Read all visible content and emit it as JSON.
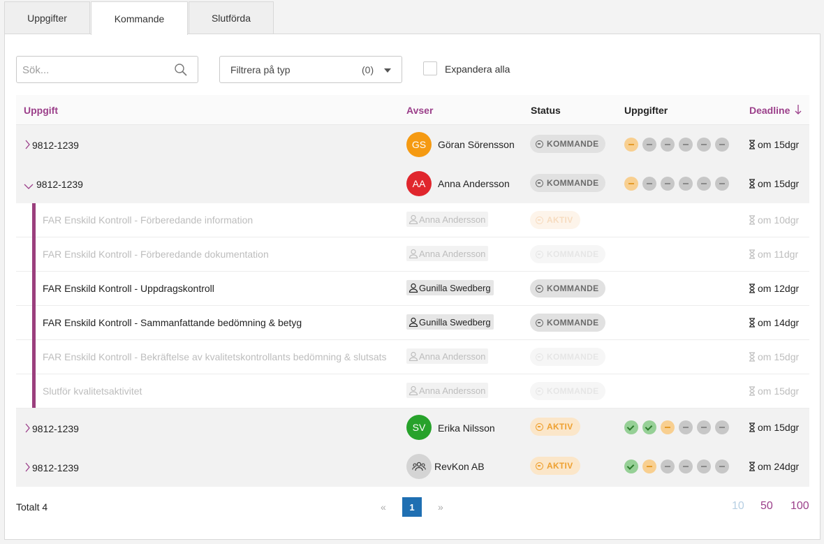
{
  "tabs": [
    "Uppgifter",
    "Kommande",
    "Slutförda"
  ],
  "active_tab": "Kommande",
  "search": {
    "placeholder": "Sök..."
  },
  "filter": {
    "label": "Filtrera på typ",
    "count": "(0)"
  },
  "expand_all": "Expandera alla",
  "columns": {
    "task": "Uppgift",
    "concerns": "Avser",
    "status": "Status",
    "subtasks": "Uppgifter",
    "deadline": "Deadline"
  },
  "groups": [
    {
      "id": "9812-1239",
      "initials": "GS",
      "name": "Göran Sörensson",
      "avatar_color": "#f59a12",
      "status": "KOMMANDE",
      "progress": [
        "pending",
        "todo",
        "todo",
        "todo",
        "todo",
        "todo"
      ],
      "deadline": "om 15dgr"
    },
    {
      "id": "9812-1239",
      "initials": "AA",
      "name": "Anna Andersson",
      "avatar_color": "#e0262d",
      "status": "KOMMANDE",
      "progress": [
        "pending",
        "todo",
        "todo",
        "todo",
        "todo",
        "todo"
      ],
      "deadline": "om 15dgr"
    },
    {
      "id": "9812-1239",
      "initials": "SV",
      "name": "Erika Nilsson",
      "avatar_color": "#27a22b",
      "status": "AKTIV",
      "progress": [
        "done",
        "done",
        "pending",
        "todo",
        "todo",
        "todo"
      ],
      "deadline": "om 15dgr"
    },
    {
      "id": "9812-1239",
      "initials": "",
      "name": "RevKon AB",
      "avatar_color": "#d4d4d4",
      "status": "AKTIV",
      "progress": [
        "done",
        "pending",
        "todo",
        "todo",
        "todo",
        "todo"
      ],
      "deadline": "om 24dgr"
    }
  ],
  "subtasks": [
    {
      "title": "FAR Enskild Kontroll - Förberedande information",
      "person": "Anna Andersson",
      "status": "AKTIV",
      "deadline": "om 10dgr",
      "muted": true
    },
    {
      "title": "FAR Enskild Kontroll - Förberedande dokumentation",
      "person": "Anna Andersson",
      "status": "KOMMANDE",
      "deadline": "om 11dgr",
      "muted": true
    },
    {
      "title": "FAR Enskild Kontroll - Uppdragskontroll",
      "person": "Gunilla Swedberg",
      "status": "KOMMANDE",
      "deadline": "om 12dgr",
      "muted": false
    },
    {
      "title": "FAR Enskild Kontroll - Sammanfattande bedömning & betyg",
      "person": "Gunilla Swedberg",
      "status": "KOMMANDE",
      "deadline": "om 14dgr",
      "muted": false
    },
    {
      "title": "FAR Enskild Kontroll - Bekräftelse av kvalitetskontrollants bedömning & slutsats",
      "person": "Anna Andersson",
      "status": "KOMMANDE",
      "deadline": "om 15dgr",
      "muted": true
    },
    {
      "title": "Slutför kvalitetsaktivitet",
      "person": "Anna Andersson",
      "status": "KOMMANDE",
      "deadline": "om 15dgr",
      "muted": true
    }
  ],
  "footer": {
    "total": "Totalt 4",
    "prev": "«",
    "page": "1",
    "next": "»",
    "page_sizes": [
      "10",
      "50",
      "100"
    ]
  },
  "colors": {
    "accent": "#9b3f8a",
    "page_active": "#1f6fb2",
    "page_size_first": "#b7cfe3"
  }
}
